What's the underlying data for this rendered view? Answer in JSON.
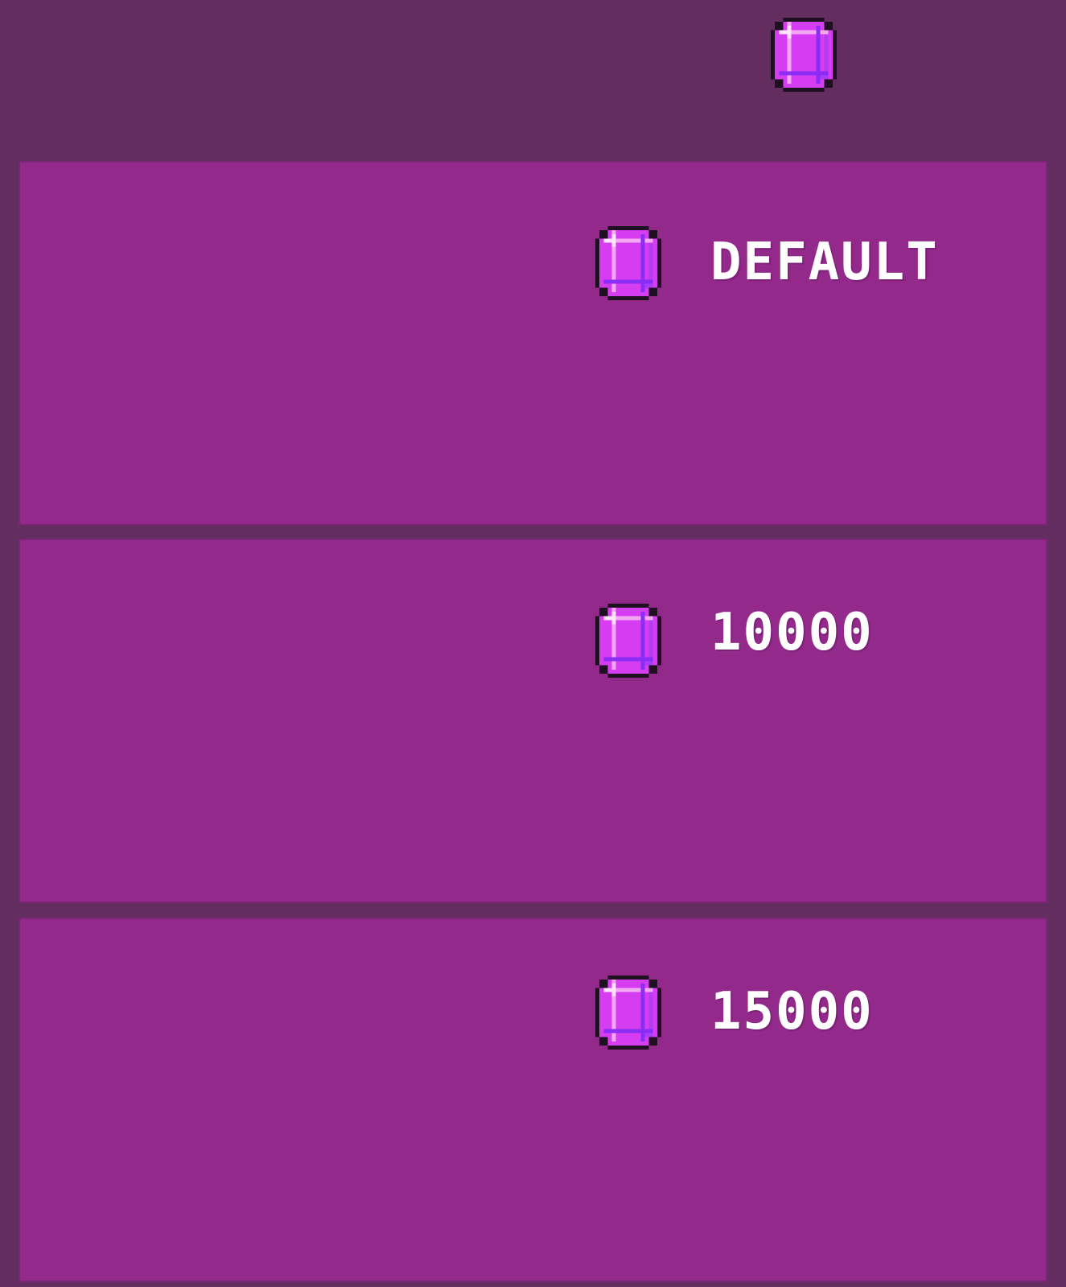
{
  "header": {
    "currency_icon": "gem-icon"
  },
  "options": [
    {
      "label": "DEFAULT",
      "icon": "gem-icon"
    },
    {
      "label": "10000",
      "icon": "gem-icon"
    },
    {
      "label": "15000",
      "icon": "gem-icon"
    }
  ],
  "colors": {
    "background": "#632d60",
    "card": "#92298b",
    "gem_main": "#d63cf0",
    "gem_highlight": "#ffd6f6",
    "gem_shadow": "#8b2df5",
    "text": "#ffffff"
  }
}
